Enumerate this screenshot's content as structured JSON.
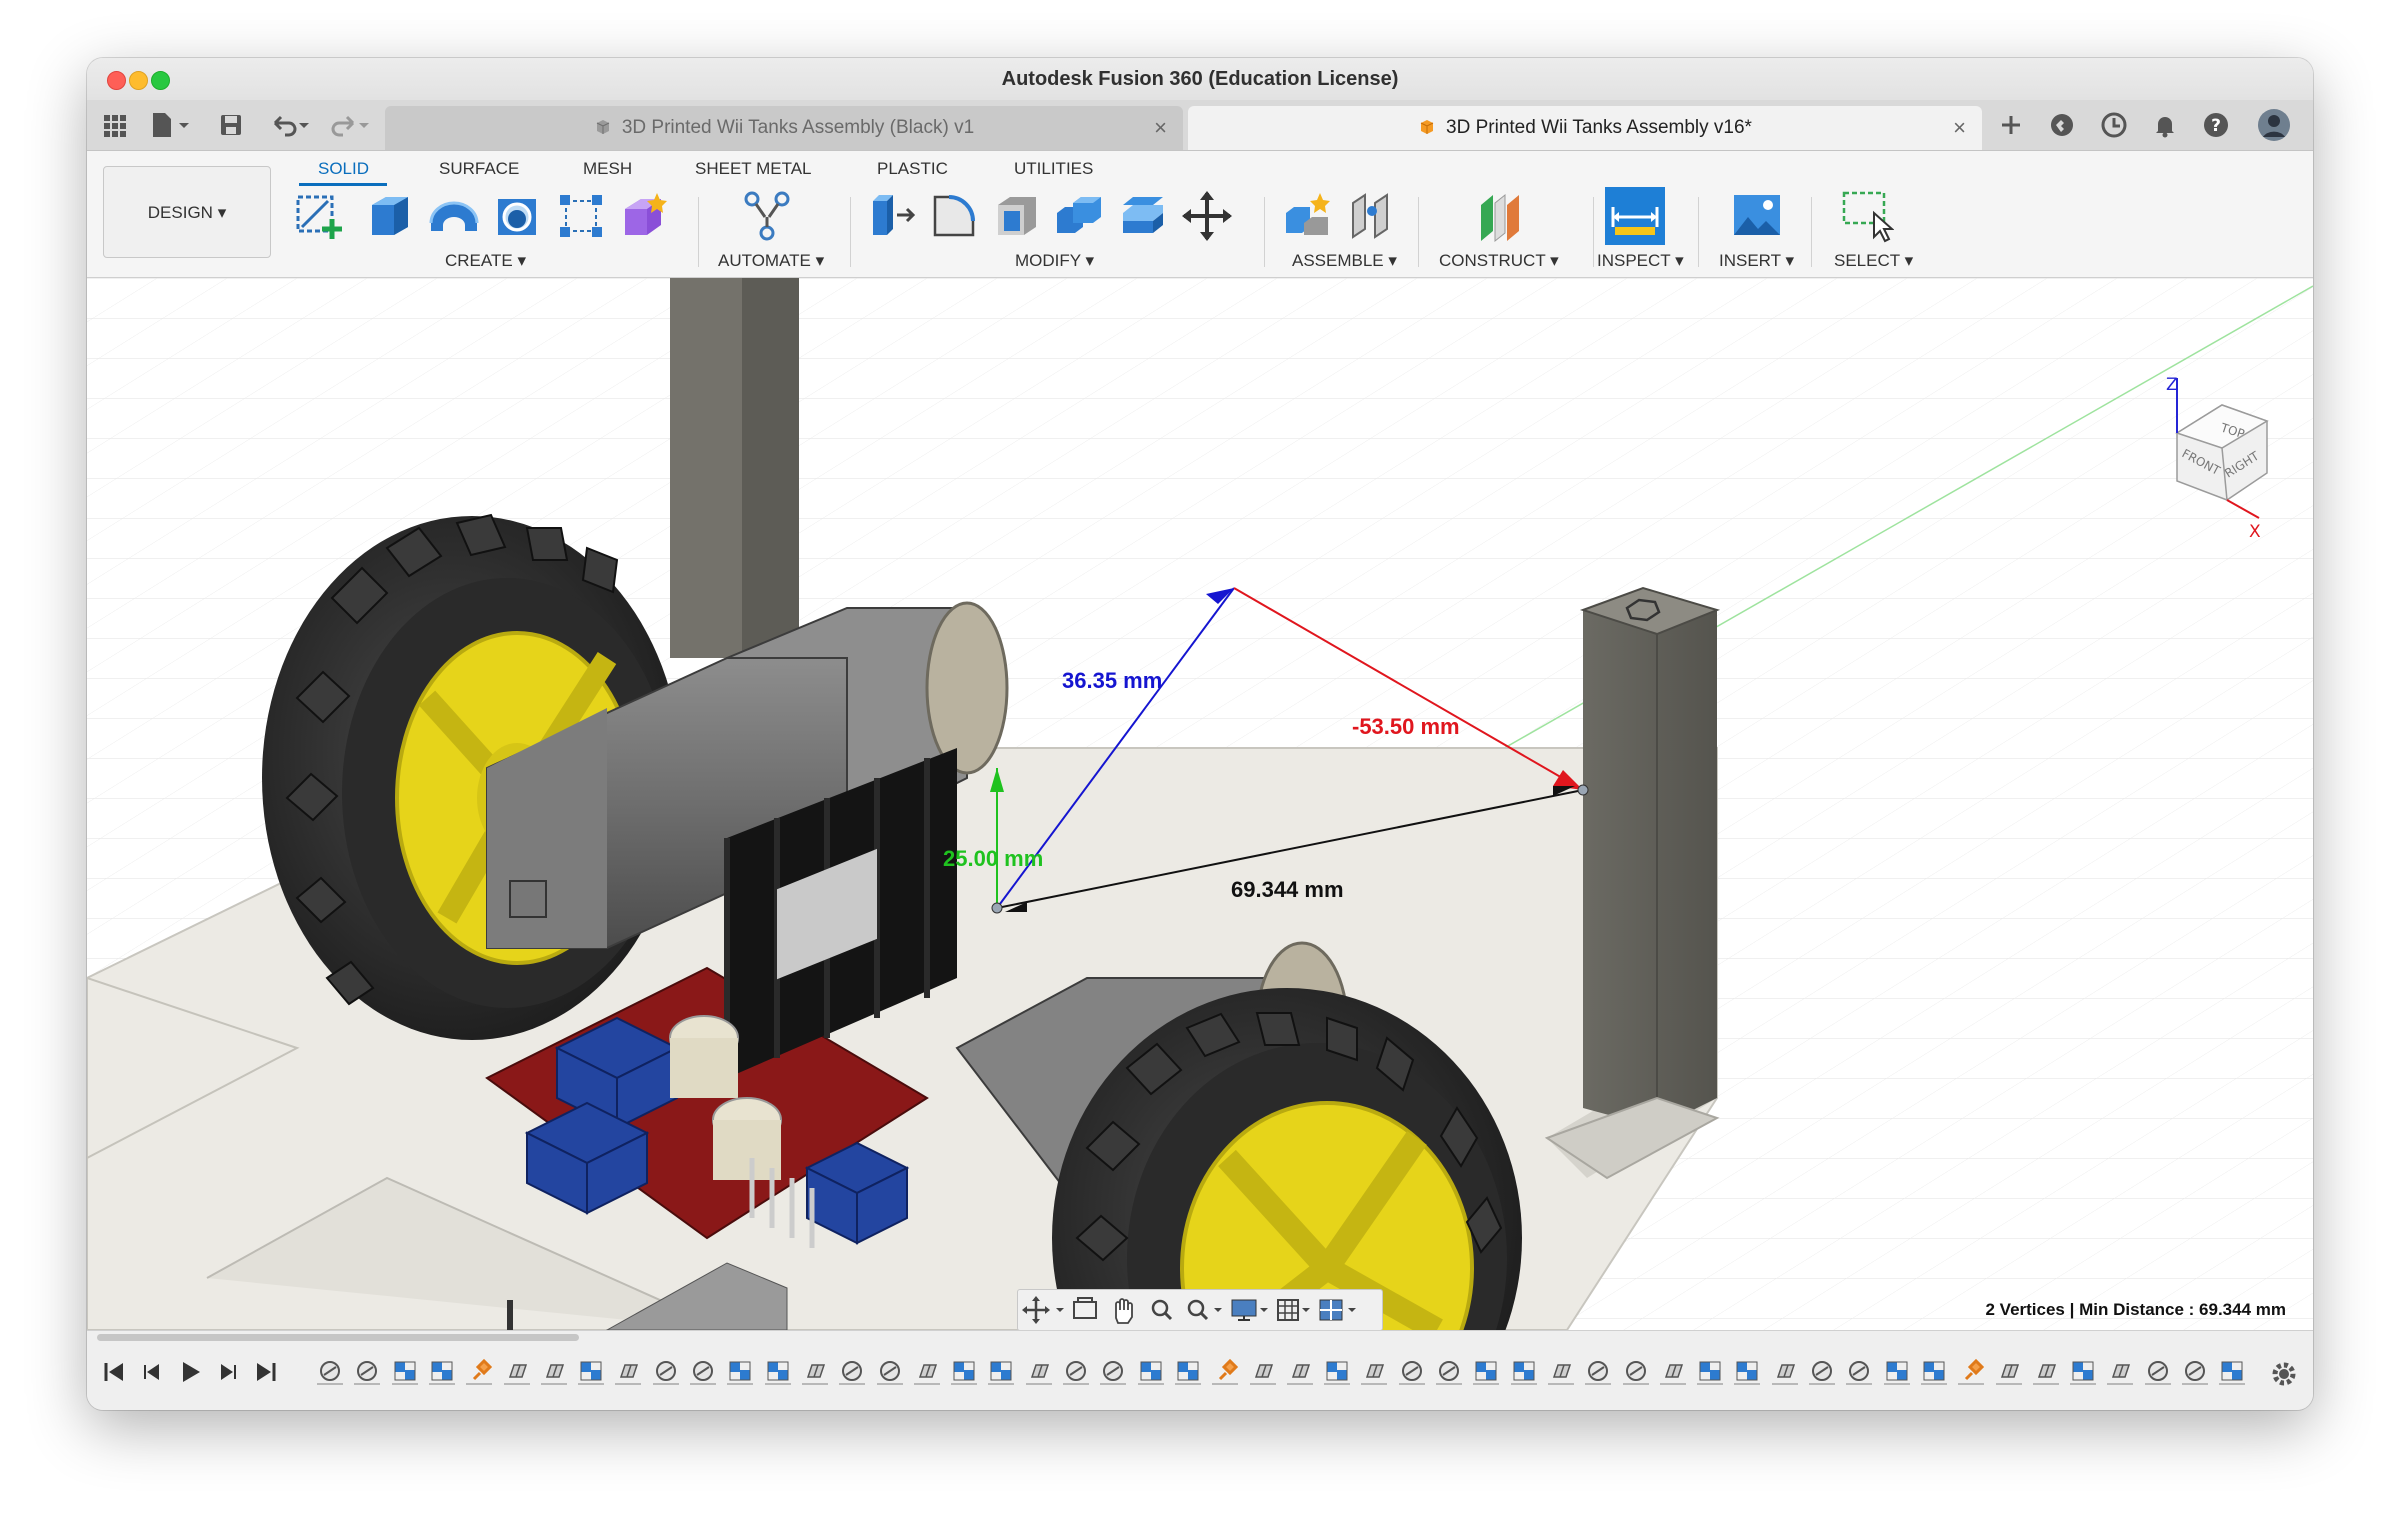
{
  "window": {
    "title": "Autodesk Fusion 360 (Education License)"
  },
  "tabs": [
    {
      "label": "3D Printed Wii Tanks Assembly (Black) v1",
      "active": false
    },
    {
      "label": "3D Printed Wii Tanks Assembly v16*",
      "active": true
    }
  ],
  "tab_close_glyph": "×",
  "quick_access": [
    "grid-icon",
    "file-icon",
    "save-icon",
    "undo-icon",
    "redo-icon"
  ],
  "header_right_icons": [
    "new-tab-icon",
    "extensions-icon",
    "job-status-icon",
    "notifications-icon",
    "help-icon",
    "profile-avatar"
  ],
  "toolbar": {
    "workspace": "DESIGN",
    "workspace_caret": "▾",
    "tabs": [
      "SOLID",
      "SURFACE",
      "MESH",
      "SHEET METAL",
      "PLASTIC",
      "UTILITIES"
    ],
    "active_tab": "SOLID",
    "groups": [
      {
        "label": "CREATE",
        "caret": "▾"
      },
      {
        "label": "AUTOMATE",
        "caret": "▾"
      },
      {
        "label": "MODIFY",
        "caret": "▾"
      },
      {
        "label": "ASSEMBLE",
        "caret": "▾"
      },
      {
        "label": "CONSTRUCT",
        "caret": "▾"
      },
      {
        "label": "INSPECT",
        "caret": "▾"
      },
      {
        "label": "INSERT",
        "caret": "▾"
      },
      {
        "label": "SELECT",
        "caret": "▾"
      }
    ]
  },
  "viewcube": {
    "faces": [
      "TOP",
      "FRONT",
      "RIGHT"
    ],
    "axes": [
      "Z",
      "X"
    ]
  },
  "measurements": {
    "z_dim": "36.35 mm",
    "x_dim": "-53.50 mm",
    "y_dim": "25.00 mm",
    "min_distance": "69.344 mm"
  },
  "status": "2 Vertices | Min Distance : 69.344 mm",
  "colors": {
    "accent": "#0a6ebd",
    "z_axis": "#1515d0",
    "x_axis": "#e0161e",
    "y_axis": "#1fc21f",
    "wheel_hub": "#e6d41a",
    "tire": "#2d2d2d"
  },
  "timeline": {
    "playback": [
      "skip-start-icon",
      "step-back-icon",
      "play-icon",
      "step-forward-icon",
      "skip-end-icon"
    ],
    "feature_count": 52
  }
}
